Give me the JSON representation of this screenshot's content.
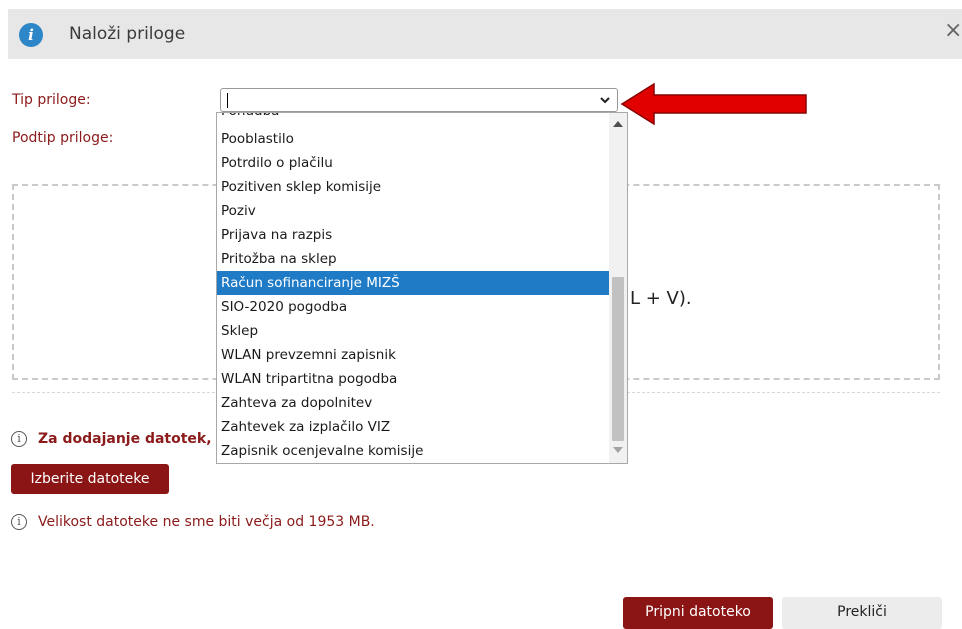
{
  "dialog": {
    "title": "Naloži priloge",
    "close_symbol": "×",
    "info_icon": "info-i",
    "header_bg": "#e7e7e7"
  },
  "form": {
    "type_label": "Tip priloge:",
    "subtype_label": "Podtip priloge:",
    "type_value": "",
    "chevron_icon": "chevron-down"
  },
  "dropdown": {
    "options": [
      "Ponudba",
      "Pooblastilo",
      "Potrdilo o plačilu",
      "Pozitiven sklep komisije",
      "Poziv",
      "Prijava na razpis",
      "Pritožba na sklep",
      "Račun sofinanciranje MIZŠ",
      "SIO-2020 pogodba",
      "Sklep",
      "WLAN prevzemni zapisnik",
      "WLAN tripartitna pogodba",
      "Zahteva za dopolnitev",
      "Zahtevek za izplačilo VIZ",
      "Zapisnik ocenjevalne komisije"
    ],
    "highlighted": "Račun sofinanciranje MIZŠ",
    "highlight_color": "#1f7bc6"
  },
  "dropzone": {
    "visible_text": "L + V)."
  },
  "instructions": {
    "add_files_text": "Za dodajanje datotek,",
    "select_files_button": "Izberite datoteke",
    "size_limit_text": "Velikost datoteke ne sme biti večja od 1953 MB.",
    "info_icon": "circle-info"
  },
  "footer": {
    "attach_button": "Pripni datoteko",
    "cancel_button": "Prekliči"
  },
  "colors": {
    "accent_red": "#8b1414",
    "label_red": "#8b1a1a",
    "arrow_red": "#e00000",
    "info_blue": "#2d86c8"
  }
}
